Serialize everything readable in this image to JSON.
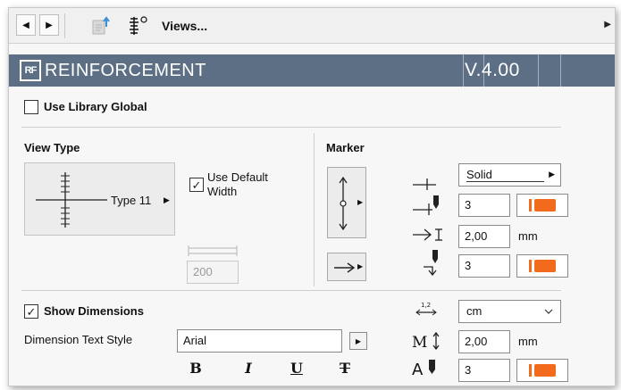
{
  "toolbar": {
    "back_glyph": "◀",
    "forward_glyph": "▶",
    "views_label": "Views...",
    "right_arrow": "▶"
  },
  "header": {
    "logo_text": "RF",
    "title": "REINFORCEMENT",
    "version": "V.4.00"
  },
  "use_library_global": {
    "label": "Use Library Global",
    "checked": false
  },
  "view_type": {
    "heading": "View Type",
    "type_label": "Type 11",
    "use_default_width_label": "Use Default\nWidth",
    "use_default_width_checked": true,
    "width_value": "200"
  },
  "marker": {
    "heading": "Marker",
    "line_style": "Solid",
    "pen_1": "3",
    "size": "2,00",
    "size_unit": "mm",
    "pen_2": "3"
  },
  "dimensions": {
    "show_label": "Show Dimensions",
    "show_checked": true,
    "text_style_label": "Dimension Text Style",
    "font_value": "Arial",
    "unit_value": "cm",
    "text_size": "2,00",
    "text_size_unit": "mm",
    "pen": "3",
    "format_buttons": [
      "B",
      "I",
      "U",
      "T"
    ]
  },
  "icons": [
    "back-arrow-icon",
    "forward-arrow-icon",
    "view-settings-icon",
    "ruler-views-icon",
    "dropdown-chevron-icon",
    "pen-color-icon"
  ],
  "colors": {
    "header_bg": "#5d6f85",
    "pen_orange": "#f26a1b"
  }
}
